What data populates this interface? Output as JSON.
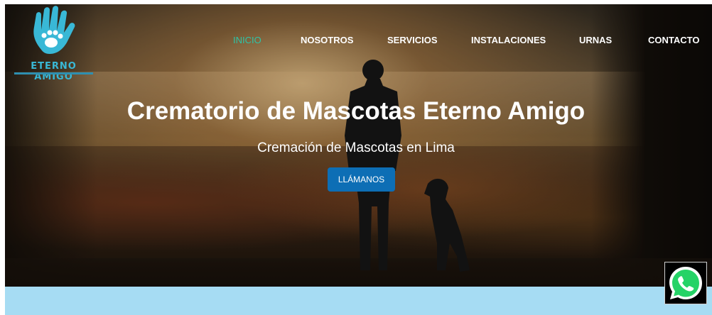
{
  "brand": {
    "logo_text": "ETERNO AMIGO",
    "colors": {
      "primary": "#39b8d6",
      "accent": "#2ec4a6"
    }
  },
  "nav": {
    "items": [
      {
        "label": "INICIO",
        "active": true
      },
      {
        "label": "NOSOTROS"
      },
      {
        "label": "SERVICIOS"
      },
      {
        "label": "INSTALACIONES"
      },
      {
        "label": "URNAS"
      },
      {
        "label": "CONTACTO"
      }
    ]
  },
  "hero": {
    "title": "Crematorio de Mascotas Eterno Amigo",
    "subtitle": "Cremación de Mascotas en Lima",
    "cta_label": "LLÁMANOS",
    "cta_color": "#0d6eb5"
  },
  "whatsapp": {
    "icon": "whatsapp-icon",
    "color": "#25d366"
  },
  "band": {
    "color": "#a6dcf3"
  }
}
